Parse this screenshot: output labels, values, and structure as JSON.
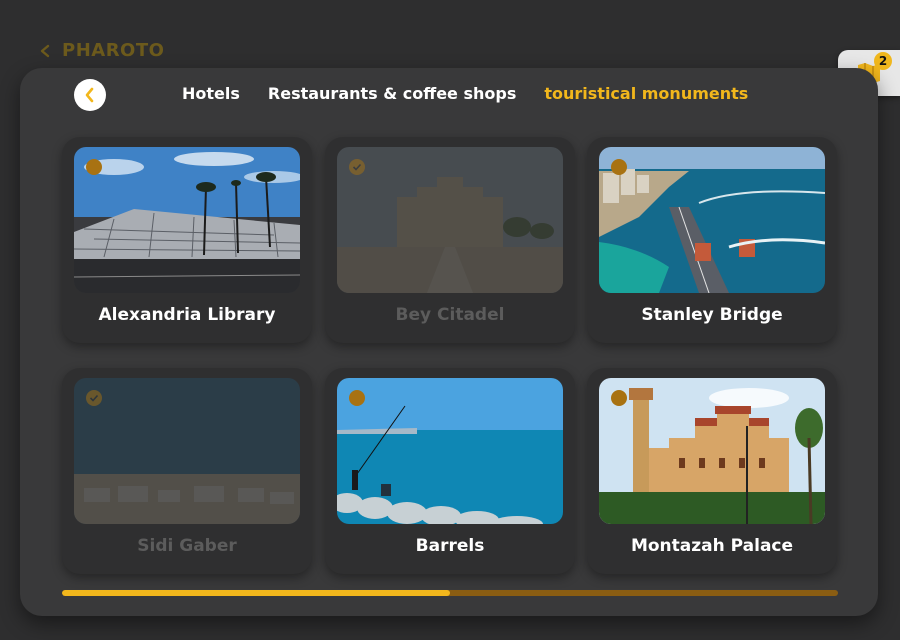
{
  "app": {
    "brand": "PHAROTO"
  },
  "map_button": {
    "icon": "map-icon",
    "badge_count": "2"
  },
  "tabs": [
    {
      "label": "Hotels",
      "active": false
    },
    {
      "label": "Restaurants & coffee shops",
      "active": false
    },
    {
      "label": "touristical monuments",
      "active": true
    }
  ],
  "cards": [
    {
      "title": "Alexandria Library",
      "visited": false,
      "image": "modern-library-photo"
    },
    {
      "title": "Bey Citadel",
      "visited": true,
      "image": "citadel-photo"
    },
    {
      "title": "Stanley Bridge",
      "visited": false,
      "image": "bridge-coast-photo"
    },
    {
      "title": "Sidi Gaber",
      "visited": true,
      "image": "beach-aerial-photo"
    },
    {
      "title": "Barrels",
      "visited": false,
      "image": "sea-fishermen-photo"
    },
    {
      "title": "Montazah Palace",
      "visited": false,
      "image": "palace-photo"
    }
  ],
  "progress": {
    "fraction": 0.5
  },
  "colors": {
    "accent": "#f2b71c",
    "dot": "#a87212",
    "background": "#2e2e2f",
    "panel": "#39393a"
  }
}
